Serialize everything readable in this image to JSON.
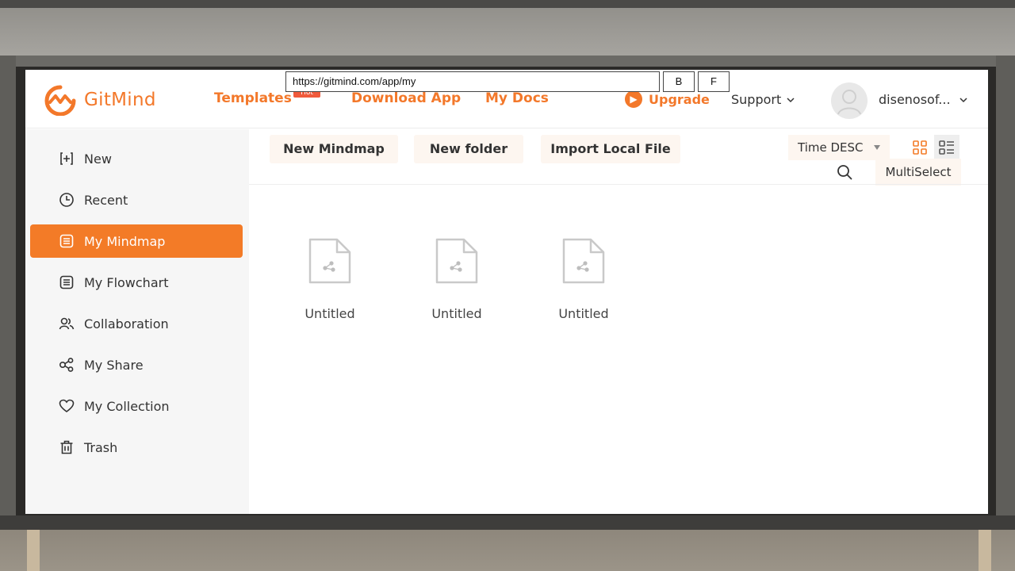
{
  "browser": {
    "url": "https://gitmind.com/app/my",
    "buttons": [
      "B",
      "F"
    ]
  },
  "header": {
    "logo_text": "GitMind",
    "nav": [
      {
        "label": "Templates",
        "badge": "Hot"
      },
      {
        "label": "Download App"
      },
      {
        "label": "My Docs"
      }
    ],
    "upgrade_label": "Upgrade",
    "support_label": "Support",
    "username": "disenosof..."
  },
  "sidebar": {
    "items": [
      {
        "label": "New",
        "icon": "plus-square-icon"
      },
      {
        "label": "Recent",
        "icon": "clock-icon"
      },
      {
        "label": "My Mindmap",
        "icon": "doc-list-icon",
        "active": true
      },
      {
        "label": "My Flowchart",
        "icon": "doc-list-icon"
      },
      {
        "label": "Collaboration",
        "icon": "people-icon"
      },
      {
        "label": "My Share",
        "icon": "share-icon"
      },
      {
        "label": "My Collection",
        "icon": "heart-icon"
      },
      {
        "label": "Trash",
        "icon": "trash-icon"
      }
    ]
  },
  "toolbar": {
    "new_mindmap": "New Mindmap",
    "new_folder": "New folder",
    "import_local": "Import Local File",
    "sort": "Time DESC",
    "multiselect": "MultiSelect"
  },
  "files": [
    {
      "name": "Untitled"
    },
    {
      "name": "Untitled"
    },
    {
      "name": "Untitled"
    }
  ],
  "colors": {
    "accent": "#f37b27",
    "sidebar_bg": "#f6f6f6",
    "button_bg": "#fdf6f0"
  }
}
